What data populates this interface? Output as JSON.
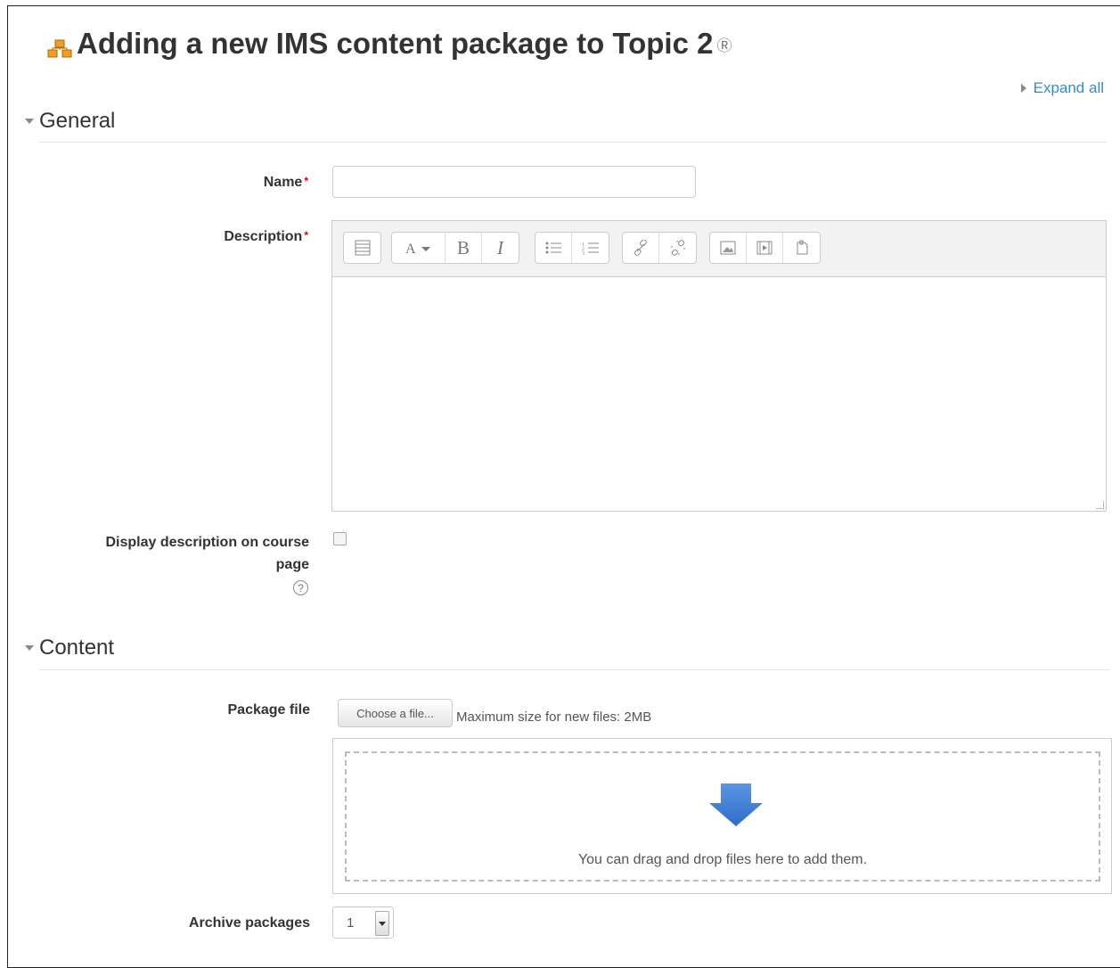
{
  "page": {
    "title": "Adding a new IMS content package to Topic 2",
    "expand_all": "Expand all"
  },
  "sections": {
    "general": "General",
    "content": "Content"
  },
  "fields": {
    "name_label": "Name",
    "name_value": "",
    "description_label": "Description",
    "display_description_label_line1": "Display description on course",
    "display_description_label_line2": "page",
    "display_description_checked": false,
    "package_file_label": "Package file",
    "choose_file_button": "Choose a file...",
    "max_size_text": "Maximum size for new files: 2MB",
    "dropzone_text": "You can drag and drop files here to add them.",
    "archive_packages_label": "Archive packages",
    "archive_packages_value": "1"
  },
  "required_marker": "*",
  "toolbar": {
    "groups": [
      [
        "toggle-toolbar-icon"
      ],
      [
        "font-style-icon",
        "bold-icon",
        "italic-icon"
      ],
      [
        "unordered-list-icon",
        "ordered-list-icon"
      ],
      [
        "link-icon",
        "unlink-icon"
      ],
      [
        "image-icon",
        "media-icon",
        "manage-files-icon"
      ]
    ]
  },
  "colors": {
    "link": "#2a8fd0",
    "required": "#dd0000",
    "arrow": "#3c7dd9"
  }
}
